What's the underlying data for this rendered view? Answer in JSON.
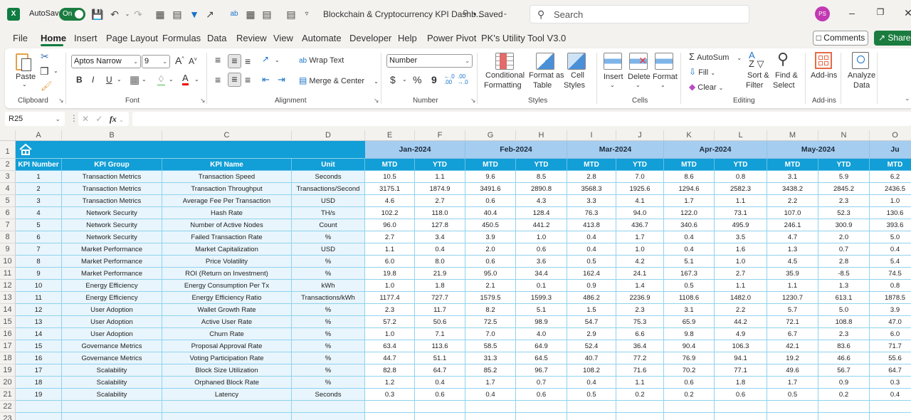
{
  "titlebar": {
    "app_logo": "X",
    "autosave_label": "AutoSave",
    "autosave_state": "On",
    "document_title": "Blockchain & Cryptocurrency KPI Dashb...",
    "saved_status": "• Saved",
    "search_placeholder": "Search",
    "user_initials": "PS",
    "user_avatar_color": "#c239b3"
  },
  "tabs": [
    "File",
    "Home",
    "Insert",
    "Page Layout",
    "Formulas",
    "Data",
    "Review",
    "View",
    "Automate",
    "Developer",
    "Help",
    "Power Pivot",
    "PK's Utility Tool V3.0"
  ],
  "active_tab": "Home",
  "actions": {
    "comments": "Comments",
    "share": "Share"
  },
  "ribbon": {
    "clipboard": {
      "paste": "Paste",
      "group": "Clipboard"
    },
    "font": {
      "name": "Aptos Narrow",
      "size": "9",
      "bold": "B",
      "italic": "I",
      "underline": "U",
      "group": "Font"
    },
    "alignment": {
      "wrap_text": "Wrap Text",
      "merge_center": "Merge & Center",
      "group": "Alignment"
    },
    "number": {
      "format": "Number",
      "currency": "$",
      "percent": "%",
      "comma": "9",
      "group": "Number"
    },
    "styles": {
      "conditional_1": "Conditional",
      "conditional_2": "Formatting",
      "format_table_1": "Format as",
      "format_table_2": "Table",
      "cell_styles_1": "Cell",
      "cell_styles_2": "Styles",
      "group": "Styles"
    },
    "cells": {
      "insert": "Insert",
      "delete": "Delete",
      "format": "Format",
      "group": "Cells"
    },
    "editing": {
      "autosum": "AutoSum",
      "fill": "Fill",
      "clear": "Clear",
      "sort_1": "Sort &",
      "sort_2": "Filter",
      "find_1": "Find &",
      "find_2": "Select",
      "group": "Editing"
    },
    "addins": {
      "addins": "Add-ins",
      "group": "Add-ins"
    },
    "analyze": {
      "line1": "Analyze",
      "line2": "Data"
    }
  },
  "formula_bar": {
    "name_box": "R25",
    "fx": "fx",
    "formula": ""
  },
  "colors": {
    "header_blue": "#129ed6",
    "month_band": "#a5cdf0",
    "data_fill": "#e8f5fc",
    "grid_line": "#8fd3ee",
    "excel_green": "#107c41"
  },
  "sheet": {
    "column_letters": [
      "A",
      "B",
      "C",
      "D",
      "E",
      "F",
      "G",
      "H",
      "I",
      "J",
      "K",
      "L",
      "M",
      "N",
      "O"
    ],
    "row_numbers": [
      "1",
      "2",
      "3",
      "4",
      "5",
      "6",
      "7",
      "8",
      "9",
      "10",
      "11",
      "12",
      "13",
      "14",
      "15",
      "16",
      "17",
      "18",
      "19",
      "20",
      "21",
      "22",
      "23"
    ],
    "home_icon": "house-icon",
    "months": [
      "Jan-2024",
      "Feb-2024",
      "Mar-2024",
      "Apr-2024",
      "May-2024",
      "Ju"
    ],
    "headers": [
      "KPI Number",
      "KPI Group",
      "KPI Name",
      "Unit"
    ],
    "sub_headers": [
      "MTD",
      "YTD",
      "MTD",
      "YTD",
      "MTD",
      "YTD",
      "MTD",
      "YTD",
      "MTD",
      "YTD",
      "MTD"
    ],
    "rows": [
      {
        "num": "1",
        "group": "Transaction Metrics",
        "name": "Transaction Speed",
        "unit": "Seconds",
        "values": [
          "10.5",
          "1.1",
          "9.6",
          "8.5",
          "2.8",
          "7.0",
          "8.6",
          "0.8",
          "3.1",
          "5.9",
          "6.2"
        ]
      },
      {
        "num": "2",
        "group": "Transaction Metrics",
        "name": "Transaction Throughput",
        "unit": "Transactions/Second",
        "values": [
          "3175.1",
          "1874.9",
          "3491.6",
          "2890.8",
          "3568.3",
          "1925.6",
          "1294.6",
          "2582.3",
          "3438.2",
          "2845.2",
          "2436.5"
        ]
      },
      {
        "num": "3",
        "group": "Transaction Metrics",
        "name": "Average Fee Per Transaction",
        "unit": "USD",
        "values": [
          "4.6",
          "2.7",
          "0.6",
          "4.3",
          "3.3",
          "4.1",
          "1.7",
          "1.1",
          "2.2",
          "2.3",
          "1.0"
        ]
      },
      {
        "num": "4",
        "group": "Network Security",
        "name": "Hash Rate",
        "unit": "TH/s",
        "values": [
          "102.2",
          "118.0",
          "40.4",
          "128.4",
          "76.3",
          "94.0",
          "122.0",
          "73.1",
          "107.0",
          "52.3",
          "130.6"
        ]
      },
      {
        "num": "5",
        "group": "Network Security",
        "name": "Number of Active Nodes",
        "unit": "Count",
        "values": [
          "96.0",
          "127.8",
          "450.5",
          "441.2",
          "413.8",
          "436.7",
          "340.6",
          "495.9",
          "246.1",
          "300.9",
          "393.6"
        ]
      },
      {
        "num": "6",
        "group": "Network Security",
        "name": "Failed Transaction Rate",
        "unit": "%",
        "values": [
          "2.7",
          "3.4",
          "3.9",
          "1.0",
          "0.4",
          "1.7",
          "0.4",
          "3.5",
          "4.7",
          "2.0",
          "5.0"
        ]
      },
      {
        "num": "7",
        "group": "Market Performance",
        "name": "Market Capitalization",
        "unit": "USD",
        "values": [
          "1.1",
          "0.4",
          "2.0",
          "0.6",
          "0.4",
          "1.0",
          "0.4",
          "1.6",
          "1.3",
          "0.7",
          "0.4"
        ]
      },
      {
        "num": "8",
        "group": "Market Performance",
        "name": "Price Volatility",
        "unit": "%",
        "values": [
          "6.0",
          "8.0",
          "0.6",
          "3.6",
          "0.5",
          "4.2",
          "5.1",
          "1.0",
          "4.5",
          "2.8",
          "5.4"
        ]
      },
      {
        "num": "9",
        "group": "Market Performance",
        "name": "ROI (Return on Investment)",
        "unit": "%",
        "values": [
          "19.8",
          "21.9",
          "95.0",
          "34.4",
          "162.4",
          "24.1",
          "167.3",
          "2.7",
          "35.9",
          "-8.5",
          "74.5"
        ]
      },
      {
        "num": "10",
        "group": "Energy Efficiency",
        "name": "Energy Consumption Per Tx",
        "unit": "kWh",
        "values": [
          "1.0",
          "1.8",
          "2.1",
          "0.1",
          "0.9",
          "1.4",
          "0.5",
          "1.1",
          "1.1",
          "1.3",
          "0.8"
        ]
      },
      {
        "num": "11",
        "group": "Energy Efficiency",
        "name": "Energy Efficiency Ratio",
        "unit": "Transactions/kWh",
        "values": [
          "1177.4",
          "727.7",
          "1579.5",
          "1599.3",
          "486.2",
          "2236.9",
          "1108.6",
          "1482.0",
          "1230.7",
          "613.1",
          "1878.5"
        ]
      },
      {
        "num": "12",
        "group": "User Adoption",
        "name": "Wallet Growth Rate",
        "unit": "%",
        "values": [
          "2.3",
          "11.7",
          "8.2",
          "5.1",
          "1.5",
          "2.3",
          "3.1",
          "2.2",
          "5.7",
          "5.0",
          "3.9"
        ]
      },
      {
        "num": "13",
        "group": "User Adoption",
        "name": "Active User Rate",
        "unit": "%",
        "values": [
          "57.2",
          "50.6",
          "72.5",
          "98.9",
          "54.7",
          "75.3",
          "65.9",
          "44.2",
          "72.1",
          "108.8",
          "47.0"
        ]
      },
      {
        "num": "14",
        "group": "User Adoption",
        "name": "Churn Rate",
        "unit": "%",
        "values": [
          "1.0",
          "7.1",
          "7.0",
          "4.0",
          "2.9",
          "6.6",
          "9.8",
          "4.9",
          "6.7",
          "2.3",
          "6.0"
        ]
      },
      {
        "num": "15",
        "group": "Governance Metrics",
        "name": "Proposal Approval Rate",
        "unit": "%",
        "values": [
          "63.4",
          "113.6",
          "58.5",
          "64.9",
          "52.4",
          "36.4",
          "90.4",
          "106.3",
          "42.1",
          "83.6",
          "71.7"
        ]
      },
      {
        "num": "16",
        "group": "Governance Metrics",
        "name": "Voting Participation Rate",
        "unit": "%",
        "values": [
          "44.7",
          "51.1",
          "31.3",
          "64.5",
          "40.7",
          "77.2",
          "76.9",
          "94.1",
          "19.2",
          "46.6",
          "55.6"
        ]
      },
      {
        "num": "17",
        "group": "Scalability",
        "name": "Block Size Utilization",
        "unit": "%",
        "values": [
          "82.8",
          "64.7",
          "85.2",
          "96.7",
          "108.2",
          "71.6",
          "70.2",
          "77.1",
          "49.6",
          "56.7",
          "64.7"
        ]
      },
      {
        "num": "18",
        "group": "Scalability",
        "name": "Orphaned Block Rate",
        "unit": "%",
        "values": [
          "1.2",
          "0.4",
          "1.7",
          "0.7",
          "0.4",
          "1.1",
          "0.6",
          "1.8",
          "1.7",
          "0.9",
          "0.3"
        ]
      },
      {
        "num": "19",
        "group": "Scalability",
        "name": "Latency",
        "unit": "Seconds",
        "values": [
          "0.3",
          "0.6",
          "0.4",
          "0.6",
          "0.5",
          "0.2",
          "0.2",
          "0.6",
          "0.5",
          "0.2",
          "0.4"
        ]
      }
    ]
  }
}
